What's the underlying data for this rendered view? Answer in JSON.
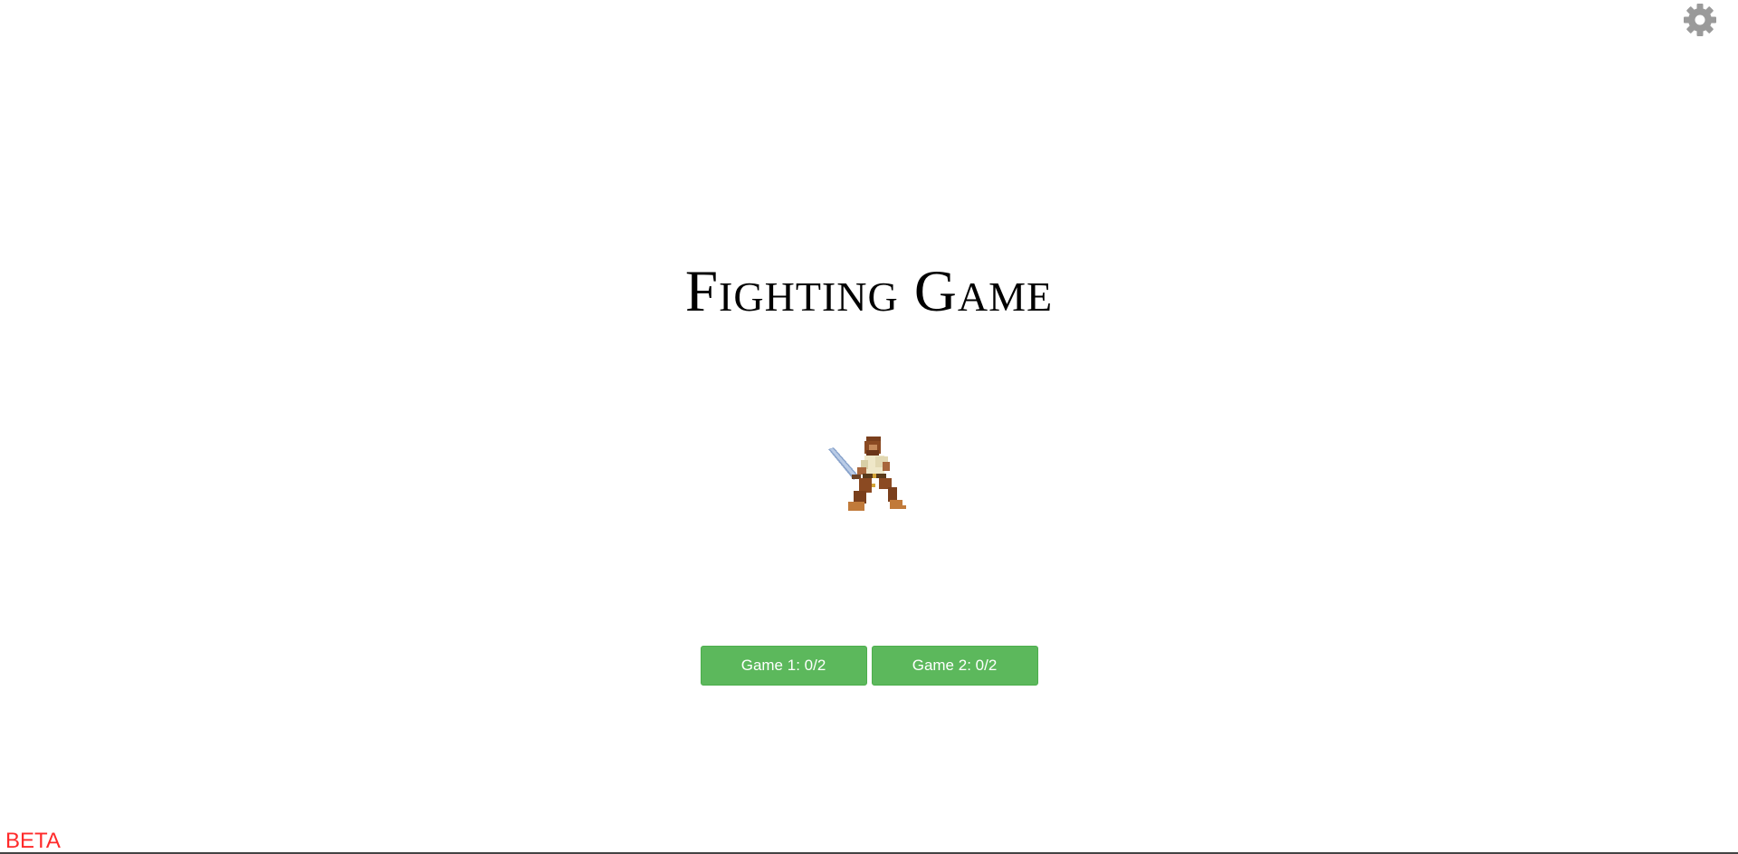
{
  "title": "Fighting Game",
  "settings": {
    "icon": "gear-icon",
    "color": "#9a9a9a"
  },
  "character": {
    "icon": "sword-fighter-sprite"
  },
  "buttons": [
    {
      "label": "Game 1: 0/2"
    },
    {
      "label": "Game 2: 0/2"
    }
  ],
  "button_color": "#5cb85c",
  "beta_label": "BETA",
  "beta_color": "#ff2a2a"
}
